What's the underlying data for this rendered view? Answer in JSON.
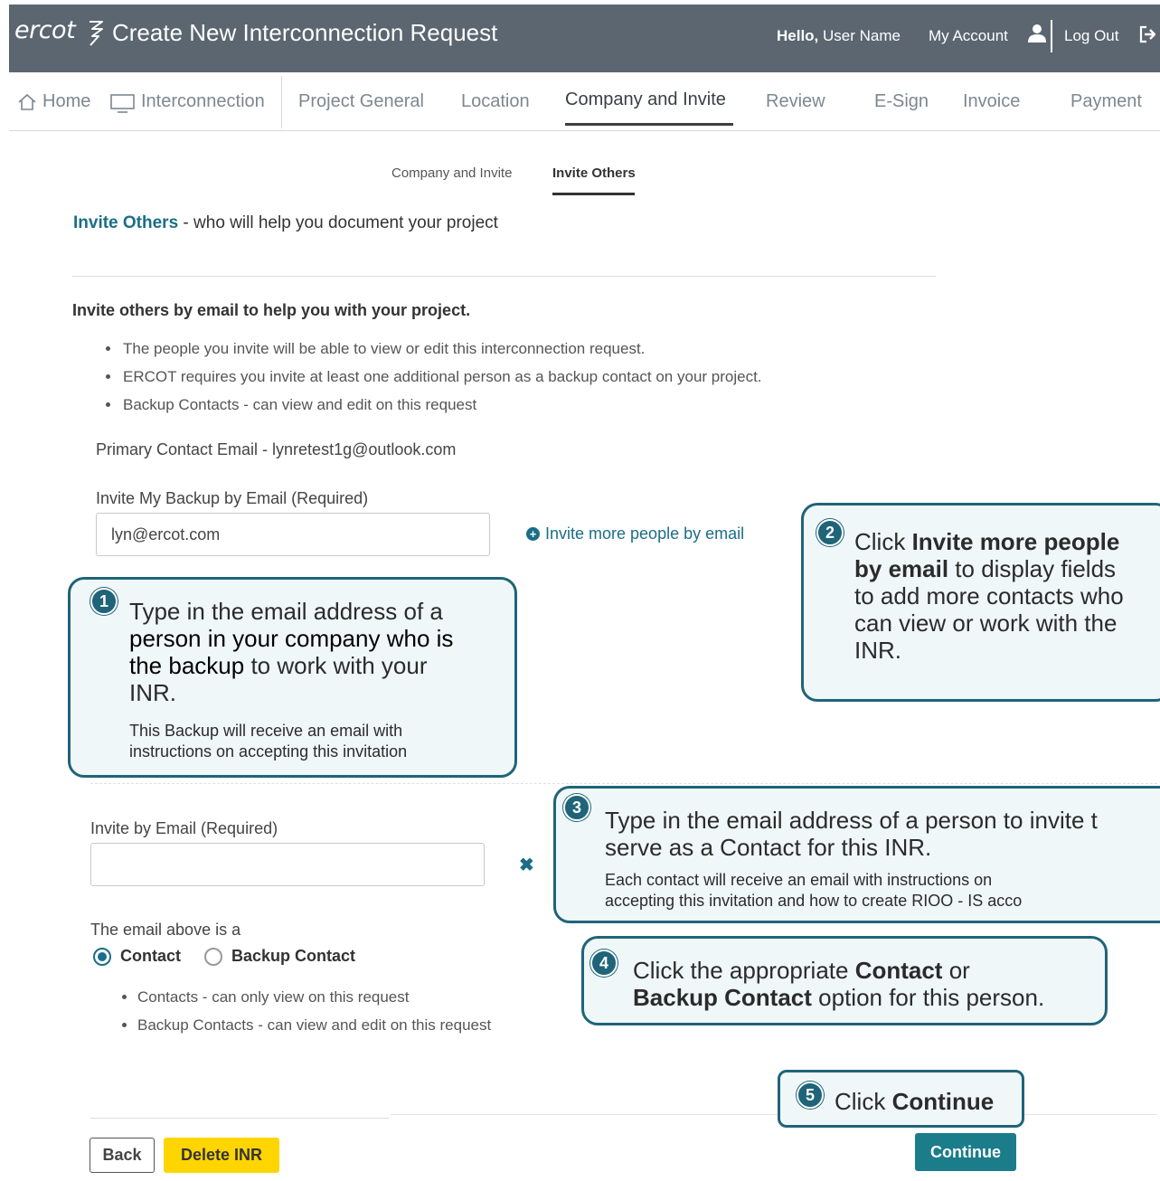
{
  "header": {
    "logo": "ercot",
    "title": "Create New Interconnection Request",
    "hello_prefix": "Hello,",
    "user_name": "User Name",
    "my_account": "My Account",
    "log_out": "Log Out"
  },
  "nav": {
    "home": "Home",
    "interconnection": "Interconnection",
    "tabs": [
      "Project General",
      "Location",
      "Company and Invite",
      "Review",
      "E-Sign",
      "Invoice",
      "Payment"
    ],
    "active_tab": "Company and Invite"
  },
  "subtabs": [
    "Company and Invite",
    "Invite Others"
  ],
  "section": {
    "title_highlight": "Invite Others",
    "title_rest": " - who will help you document your project"
  },
  "intro": {
    "heading": "Invite others by email to help you with your project.",
    "bullets": [
      "The people you invite will be able to view or edit this interconnection request.",
      "ERCOT requires you invite at least one additional person as a backup contact on your project.",
      "Backup Contacts - can view and edit on this request"
    ]
  },
  "primary_contact": "Primary Contact Email - lynretest1g@outlook.com",
  "backup_field": {
    "label": "Invite My Backup by Email (Required)",
    "value": "lyn@ercot.com"
  },
  "invite_more": "Invite more people by email",
  "invite_field": {
    "label": "Invite by Email (Required)",
    "value": ""
  },
  "email_type": {
    "label": "The email above is a",
    "options": [
      "Contact",
      "Backup Contact"
    ],
    "selected": "Contact"
  },
  "type_bullets": [
    "Contacts - can only view on this request",
    "Backup Contacts - can view and edit on this request"
  ],
  "buttons": {
    "back": "Back",
    "delete": "Delete INR",
    "continue": "Continue"
  },
  "callouts": {
    "c1": {
      "num": "1",
      "line1": "Type in the email address of a",
      "line2": "person in your company who is",
      "line3a": "the backup",
      "line3b": " to work with your",
      "line4": "INR.",
      "small1": "This Backup will receive an email with",
      "small2": "instructions on accepting this invitation"
    },
    "c2": {
      "num": "2",
      "click": "Click ",
      "bold1": "Invite more people",
      "bold2": "by email",
      "rest1": " to display fields",
      "line3": "to add more contacts who",
      "line4": "can view or work with the",
      "line5": "INR."
    },
    "c3": {
      "num": "3",
      "line1": "Type in the email address of a person to invite t",
      "line2": "serve as a Contact for this INR.",
      "small1": "Each contact will receive an email with instructions on",
      "small2": "accepting this invitation and how to create RIOO - IS acco"
    },
    "c4": {
      "num": "4",
      "click": "Click the appropriate ",
      "bold1": "Contact",
      "or": " or",
      "bold2": "Backup Contact",
      "rest": " option for this person."
    },
    "c5": {
      "num": "5",
      "click": "Click ",
      "bold": "Continue"
    }
  },
  "colors": {
    "header_bg": "#5b6670",
    "accent": "#1b6e87",
    "continue_bg": "#1b7c8a",
    "delete_bg": "#ffd500",
    "callout_border": "#1f6478"
  }
}
